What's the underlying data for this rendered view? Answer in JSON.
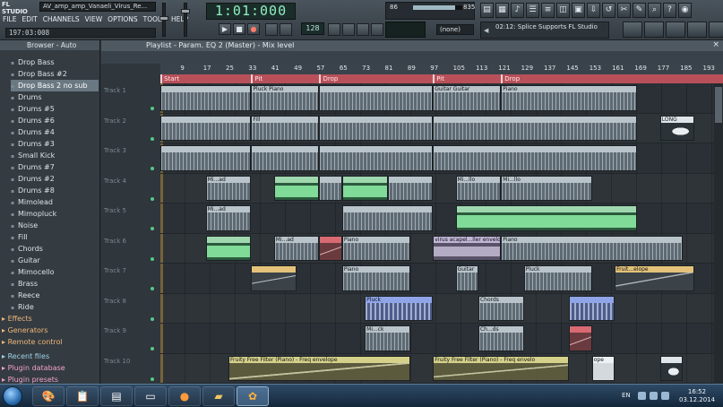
{
  "app": {
    "logo": "FL STUDIO",
    "window_title": "AV_amp_amp_Vanaeli_Virus_Re...",
    "menu": [
      "FILE",
      "EDIT",
      "CHANNELS",
      "VIEW",
      "OPTIONS",
      "TOOLS",
      "HELP"
    ],
    "song_position": "197:03:008",
    "main_time": "1:01:000",
    "tempo": "128",
    "cpu_value": "86",
    "mem_value": "835",
    "snap_value": "(none)",
    "news_text": "02:12: Splice Supports FL Studio"
  },
  "browser": {
    "header": "Browser - Auto",
    "items": [
      {
        "label": "Drop Bass",
        "selected": false
      },
      {
        "label": "Drop Bass #2",
        "selected": false
      },
      {
        "label": "Drop Bass 2 no sub",
        "selected": true
      },
      {
        "label": "Drums",
        "selected": false
      },
      {
        "label": "Drums #5",
        "selected": false
      },
      {
        "label": "Drums #6",
        "selected": false
      },
      {
        "label": "Drums #4",
        "selected": false
      },
      {
        "label": "Drums #3",
        "selected": false
      },
      {
        "label": "Small Kick",
        "selected": false
      },
      {
        "label": "Drums #7",
        "selected": false
      },
      {
        "label": "Drums #2",
        "selected": false
      },
      {
        "label": "Drums #8",
        "selected": false
      },
      {
        "label": "Mimolead",
        "selected": false
      },
      {
        "label": "Mimopluck",
        "selected": false
      },
      {
        "label": "Noise",
        "selected": false
      },
      {
        "label": "Fill",
        "selected": false
      },
      {
        "label": "Chords",
        "selected": false
      },
      {
        "label": "Guitar",
        "selected": false
      },
      {
        "label": "Mimocello",
        "selected": false
      },
      {
        "label": "Brass",
        "selected": false
      },
      {
        "label": "Reece",
        "selected": false
      },
      {
        "label": "Ride",
        "selected": false
      }
    ],
    "folders": [
      {
        "label": "Effects",
        "color": "orange"
      },
      {
        "label": "Generators",
        "color": "orange"
      },
      {
        "label": "Remote control",
        "color": "orange"
      },
      {
        "label": "Recent files",
        "color": "cyan"
      },
      {
        "label": "Plugin database",
        "color": "pink"
      },
      {
        "label": "Plugin presets",
        "color": "pink"
      }
    ]
  },
  "playlist": {
    "title": "Playlist - Param. EQ 2 (Master) - Mix level",
    "ruler": [
      "9",
      "17",
      "25",
      "33",
      "41",
      "49",
      "57",
      "65",
      "73",
      "81",
      "89",
      "97",
      "105",
      "113",
      "121",
      "129",
      "137",
      "145",
      "153",
      "161",
      "169",
      "177",
      "185",
      "193"
    ],
    "markers": [
      {
        "label": "Start",
        "bar": 1
      },
      {
        "label": "Pit",
        "bar": 33
      },
      {
        "label": "Drop",
        "bar": 57
      },
      {
        "label": "Pit",
        "bar": 97
      },
      {
        "label": "Drop",
        "bar": 121
      }
    ],
    "tracks": [
      "Track 1",
      "Track 2",
      "Track 3",
      "Track 4",
      "Track 5",
      "Track 6",
      "Track 7",
      "Track 8",
      "Track 9",
      "Track 10"
    ],
    "clips": [
      {
        "track": 0,
        "start": 1,
        "len": 32,
        "kind": "pattern",
        "label": ""
      },
      {
        "track": 0,
        "start": 33,
        "len": 24,
        "kind": "pattern",
        "label": "Pluck Piano"
      },
      {
        "track": 0,
        "start": 57,
        "len": 40,
        "kind": "pattern",
        "label": ""
      },
      {
        "track": 0,
        "start": 97,
        "len": 24,
        "kind": "pattern",
        "label": "Guitar Guitar"
      },
      {
        "track": 0,
        "start": 121,
        "len": 48,
        "kind": "pattern",
        "label": "Piano"
      },
      {
        "track": 1,
        "start": 1,
        "len": 32,
        "kind": "pattern",
        "label": ""
      },
      {
        "track": 1,
        "start": 33,
        "len": 24,
        "kind": "pattern",
        "label": "Fill"
      },
      {
        "track": 1,
        "start": 57,
        "len": 40,
        "kind": "pattern",
        "label": ""
      },
      {
        "track": 1,
        "start": 97,
        "len": 72,
        "kind": "pattern",
        "label": ""
      },
      {
        "track": 1,
        "start": 177,
        "len": 12,
        "kind": "long",
        "label": "LONG"
      },
      {
        "track": 2,
        "start": 1,
        "len": 32,
        "kind": "pattern",
        "label": ""
      },
      {
        "track": 2,
        "start": 33,
        "len": 24,
        "kind": "pattern",
        "label": ""
      },
      {
        "track": 2,
        "start": 57,
        "len": 40,
        "kind": "pattern",
        "label": ""
      },
      {
        "track": 2,
        "start": 97,
        "len": 72,
        "kind": "pattern",
        "label": ""
      },
      {
        "track": 3,
        "start": 17,
        "len": 16,
        "kind": "pattern",
        "label": "Mi...ad"
      },
      {
        "track": 3,
        "start": 41,
        "len": 16,
        "kind": "audio",
        "label": ""
      },
      {
        "track": 3,
        "start": 57,
        "len": 8,
        "kind": "pattern",
        "label": ""
      },
      {
        "track": 3,
        "start": 65,
        "len": 16,
        "kind": "audio",
        "label": ""
      },
      {
        "track": 3,
        "start": 81,
        "len": 16,
        "kind": "pattern",
        "label": ""
      },
      {
        "track": 3,
        "start": 105,
        "len": 16,
        "kind": "pattern",
        "label": "Mi...llo"
      },
      {
        "track": 3,
        "start": 121,
        "len": 32,
        "kind": "pattern",
        "label": "Mi...llo"
      },
      {
        "track": 4,
        "start": 17,
        "len": 16,
        "kind": "pattern",
        "label": "Mi...ad"
      },
      {
        "track": 4,
        "start": 65,
        "len": 32,
        "kind": "pattern",
        "label": ""
      },
      {
        "track": 4,
        "start": 105,
        "len": 64,
        "kind": "audio",
        "label": ""
      },
      {
        "track": 5,
        "start": 17,
        "len": 16,
        "kind": "audio",
        "label": ""
      },
      {
        "track": 5,
        "start": 41,
        "len": 16,
        "kind": "pattern",
        "label": "Mi...ad"
      },
      {
        "track": 5,
        "start": 57,
        "len": 8,
        "kind": "red",
        "label": ""
      },
      {
        "track": 5,
        "start": 65,
        "len": 24,
        "kind": "pattern",
        "label": "Piano"
      },
      {
        "track": 5,
        "start": 97,
        "len": 24,
        "kind": "purple",
        "label": "virus acapel...ller envelope"
      },
      {
        "track": 5,
        "start": 121,
        "len": 64,
        "kind": "pattern",
        "label": "Piano"
      },
      {
        "track": 6,
        "start": 33,
        "len": 16,
        "kind": "auto",
        "label": ""
      },
      {
        "track": 6,
        "start": 65,
        "len": 24,
        "kind": "pattern",
        "label": "Piano"
      },
      {
        "track": 6,
        "start": 105,
        "len": 8,
        "kind": "pattern",
        "label": "Guitar"
      },
      {
        "track": 6,
        "start": 129,
        "len": 24,
        "kind": "pattern",
        "label": "Pluck"
      },
      {
        "track": 6,
        "start": 161,
        "len": 28,
        "kind": "auto",
        "label": "Fruit...elope"
      },
      {
        "track": 7,
        "start": 73,
        "len": 24,
        "kind": "blue",
        "label": "Pluck"
      },
      {
        "track": 7,
        "start": 113,
        "len": 16,
        "kind": "pattern",
        "label": "Chords"
      },
      {
        "track": 7,
        "start": 145,
        "len": 16,
        "kind": "blue",
        "label": ""
      },
      {
        "track": 8,
        "start": 73,
        "len": 16,
        "kind": "pattern",
        "label": "Mi...ck"
      },
      {
        "track": 8,
        "start": 113,
        "len": 16,
        "kind": "pattern",
        "label": "Ch...ds"
      },
      {
        "track": 8,
        "start": 145,
        "len": 8,
        "kind": "red",
        "label": ""
      },
      {
        "track": 9,
        "start": 25,
        "len": 64,
        "kind": "filter",
        "label": "Fruity Free Filter (Piano) - Freq envelope"
      },
      {
        "track": 9,
        "start": 97,
        "len": 48,
        "kind": "filter",
        "label": "Fruity Free Filter (Piano) - Freq envelo"
      },
      {
        "track": 9,
        "start": 153,
        "len": 8,
        "kind": "white",
        "label": "ope"
      },
      {
        "track": 9,
        "start": 177,
        "len": 8,
        "kind": "long",
        "label": ""
      }
    ]
  },
  "taskbar": {
    "language": "EN",
    "time": "16:52",
    "date": "03.12.2014"
  }
}
